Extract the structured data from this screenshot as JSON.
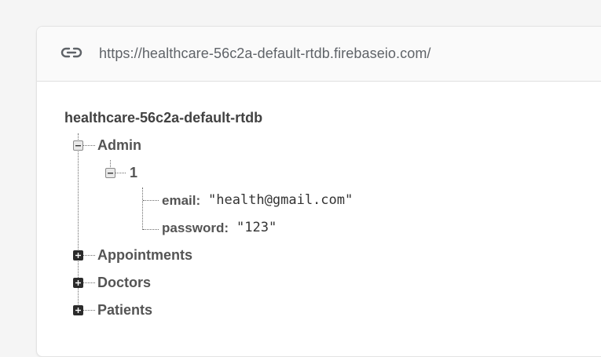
{
  "url_bar": {
    "icon": "link-icon",
    "url": "https://healthcare-56c2a-default-rtdb.firebaseio.com/"
  },
  "tree": {
    "root": "healthcare-56c2a-default-rtdb",
    "admin": {
      "label": "Admin",
      "expanded": true,
      "child": {
        "label": "1",
        "expanded": true,
        "email": {
          "key": "email:",
          "value": "\"health@gmail.com\""
        },
        "password": {
          "key": "password:",
          "value": "\"123\""
        }
      }
    },
    "appointments": {
      "label": "Appointments",
      "expanded": false
    },
    "doctors": {
      "label": "Doctors",
      "expanded": false
    },
    "patients": {
      "label": "Patients",
      "expanded": false
    }
  },
  "colors": {
    "page_bg": "#f5f5f5",
    "card_bg": "#ffffff",
    "url_bar_bg": "#fafafa",
    "label": "#545454",
    "expand_box": "#2b2b2b"
  }
}
